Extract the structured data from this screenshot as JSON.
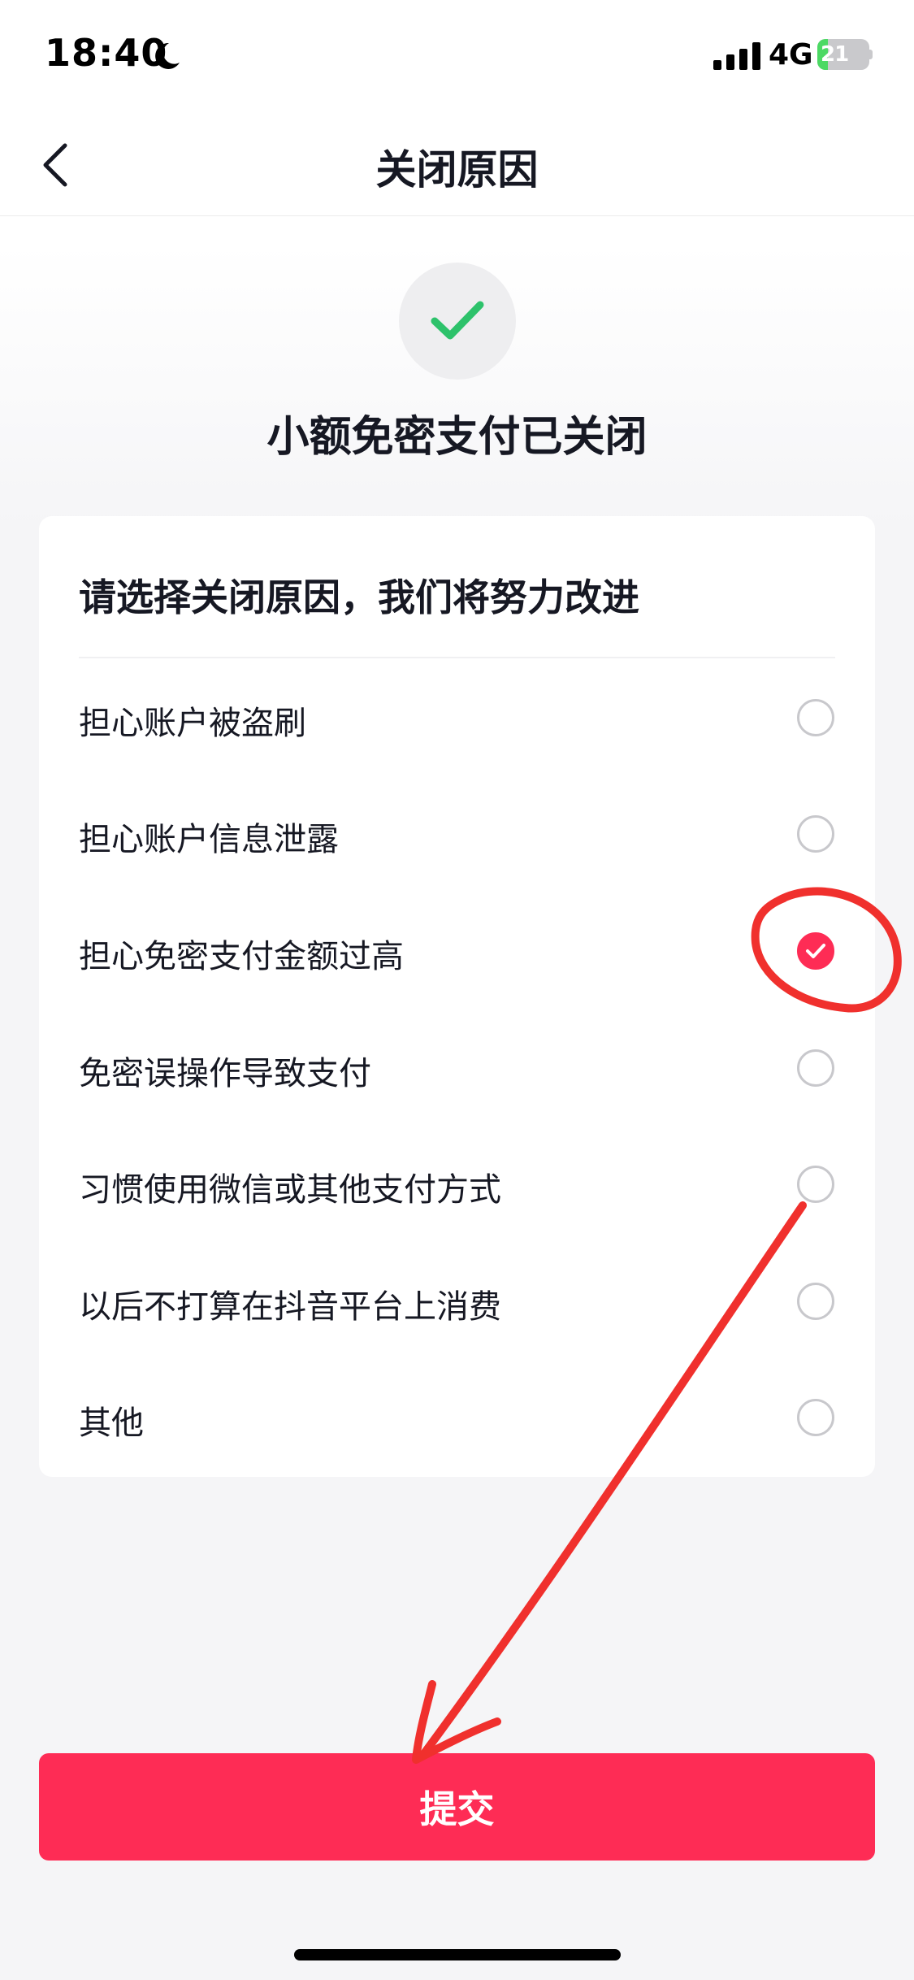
{
  "status_bar": {
    "time": "18:40",
    "network": "4G",
    "battery_level": 21,
    "battery_label": "21"
  },
  "nav": {
    "title": "关闭原因"
  },
  "success": {
    "title": "小额免密支付已关闭"
  },
  "reasons": {
    "heading": "请选择关闭原因，我们将努力改进",
    "items": [
      {
        "label": "担心账户被盗刷",
        "selected": false
      },
      {
        "label": "担心账户信息泄露",
        "selected": false
      },
      {
        "label": "担心免密支付金额过高",
        "selected": true
      },
      {
        "label": "免密误操作导致支付",
        "selected": false
      },
      {
        "label": "习惯使用微信或其他支付方式",
        "selected": false
      },
      {
        "label": "以后不打算在抖音平台上消费",
        "selected": false
      },
      {
        "label": "其他",
        "selected": false
      }
    ]
  },
  "submit": {
    "label": "提交"
  },
  "colors": {
    "accent": "#fe2c55",
    "success_green": "#2dc26b",
    "annotation_red": "#f0302d"
  },
  "icons": {
    "back": "chevron-left-icon",
    "success": "checkmark-icon",
    "moon": "moon-icon",
    "signal": "signal-bars-icon"
  }
}
